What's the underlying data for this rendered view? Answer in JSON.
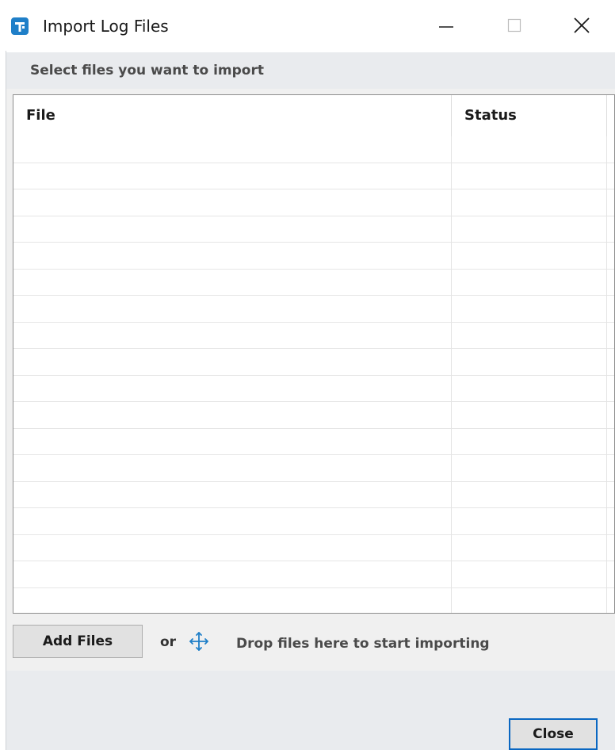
{
  "window": {
    "title": "Import Log Files",
    "icon": "app-logo-icon",
    "controls": [
      "minimize-icon",
      "maximize-icon",
      "close-icon"
    ]
  },
  "instruction": {
    "text": "Select files you want to import"
  },
  "table": {
    "columns": [
      "File",
      "Status"
    ],
    "rows": []
  },
  "actions": {
    "add_files_label": "Add Files",
    "or_label": "or",
    "drop_icon": "move-arrows-icon",
    "drop_hint": "Drop files here to start importing",
    "close_label": "Close"
  },
  "colors": {
    "accent": "#0a67c2",
    "app_icon": "#1f7fc8",
    "panel_bg": "#f0f0f0",
    "header_strip": "#e9ebee"
  }
}
